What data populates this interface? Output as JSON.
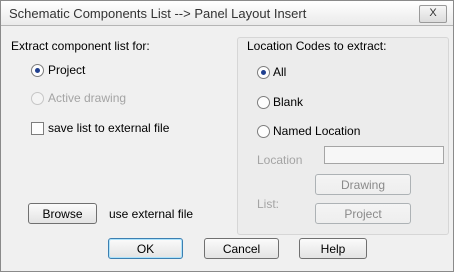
{
  "window": {
    "title": "Schematic Components List --> Panel Layout Insert",
    "close_label": "X"
  },
  "extract": {
    "heading": "Extract component list for:",
    "project_label": "Project",
    "project_checked": true,
    "active_drawing_label": "Active drawing",
    "active_drawing_enabled": false,
    "save_list_label": "save list to external file",
    "save_list_checked": false
  },
  "external": {
    "browse_label": "Browse",
    "use_external_label": "use external file"
  },
  "location_codes": {
    "heading": "Location Codes to extract:",
    "all_label": "All",
    "blank_label": "Blank",
    "named_label": "Named Location",
    "selected": "All",
    "location_label": "Location",
    "location_value": "",
    "list_label": "List:",
    "drawing_button": "Drawing",
    "project_button": "Project"
  },
  "footer": {
    "ok_label": "OK",
    "cancel_label": "Cancel",
    "help_label": "Help"
  }
}
